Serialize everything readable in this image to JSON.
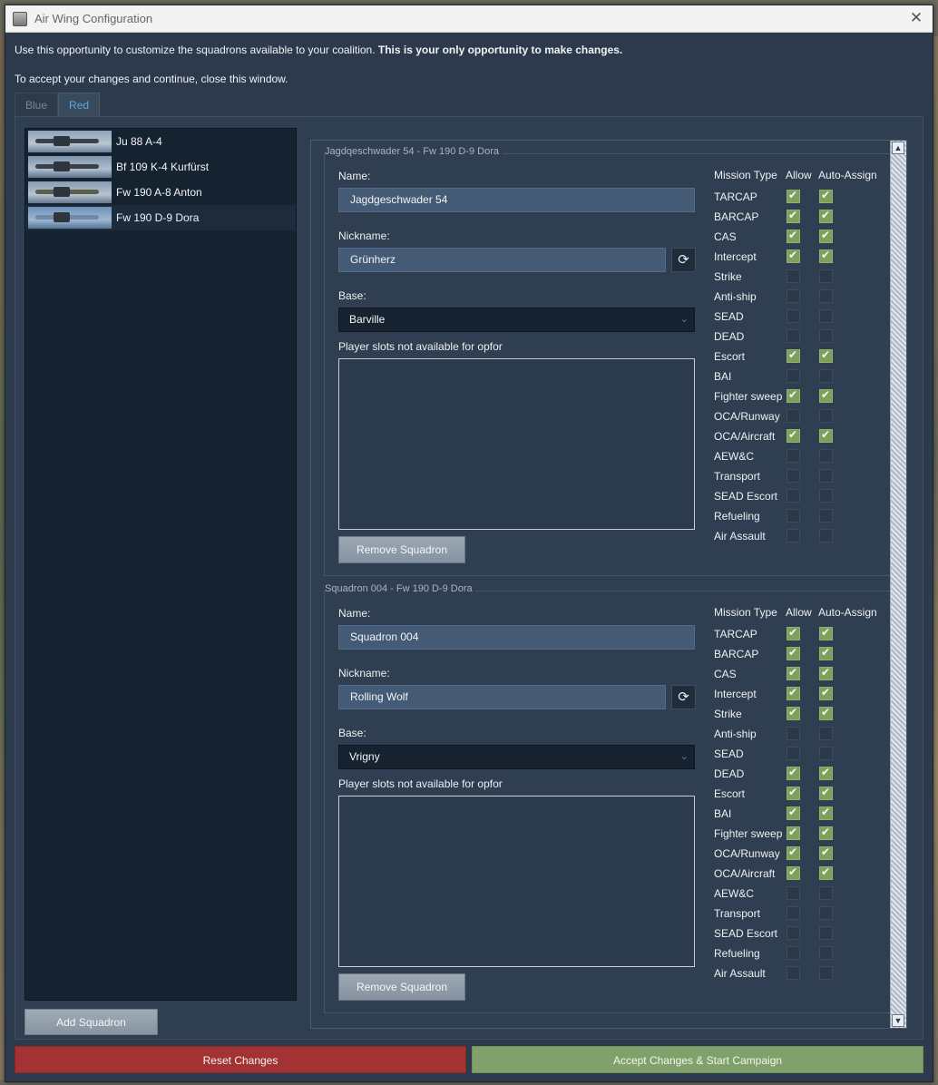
{
  "window": {
    "title": "Air Wing Configuration",
    "close_glyph": "✕"
  },
  "intro": {
    "text": "Use this opportunity to customize the squadrons available to your coalition. ",
    "bold": "This is your only opportunity to make changes.",
    "line2": "To accept your changes and continue, close this window."
  },
  "tabs": [
    {
      "label": "Blue"
    },
    {
      "label": "Red"
    }
  ],
  "aircraft": [
    {
      "label": "Ju 88 A-4"
    },
    {
      "label": "Bf 109 K-4 Kurfürst"
    },
    {
      "label": "Fw 190 A-8 Anton"
    },
    {
      "label": "Fw 190 D-9 Dora"
    }
  ],
  "add_squadron_label": "Add Squadron",
  "labels": {
    "name": "Name:",
    "nickname": "Nickname:",
    "base": "Base:",
    "slots": "Player slots not available for opfor",
    "remove": "Remove Squadron",
    "mission_type": "Mission Type",
    "allow": "Allow",
    "auto_assign": "Auto-Assign",
    "refresh_glyph": "⟳",
    "dropdown_glyph": "⌄"
  },
  "squadrons": [
    {
      "title": "Jagdqeschwader 54 - Fw 190 D-9 Dora",
      "name": "Jagdgeschwader 54",
      "nickname": "Grünherz",
      "base": "Barville",
      "missions": [
        {
          "name": "TARCAP",
          "allow": true,
          "auto": true
        },
        {
          "name": "BARCAP",
          "allow": true,
          "auto": true
        },
        {
          "name": "CAS",
          "allow": true,
          "auto": true
        },
        {
          "name": "Intercept",
          "allow": true,
          "auto": true
        },
        {
          "name": "Strike",
          "allow": false,
          "auto": false
        },
        {
          "name": "Anti-ship",
          "allow": false,
          "auto": false
        },
        {
          "name": "SEAD",
          "allow": false,
          "auto": false
        },
        {
          "name": "DEAD",
          "allow": false,
          "auto": false
        },
        {
          "name": "Escort",
          "allow": true,
          "auto": true
        },
        {
          "name": "BAI",
          "allow": false,
          "auto": false
        },
        {
          "name": "Fighter sweep",
          "allow": true,
          "auto": true
        },
        {
          "name": "OCA/Runway",
          "allow": false,
          "auto": false
        },
        {
          "name": "OCA/Aircraft",
          "allow": true,
          "auto": true
        },
        {
          "name": "AEW&C",
          "allow": false,
          "auto": false
        },
        {
          "name": "Transport",
          "allow": false,
          "auto": false
        },
        {
          "name": "SEAD Escort",
          "allow": false,
          "auto": false
        },
        {
          "name": "Refueling",
          "allow": false,
          "auto": false
        },
        {
          "name": "Air Assault",
          "allow": false,
          "auto": false
        }
      ]
    },
    {
      "title": "Squadron 004 - Fw 190 D-9 Dora",
      "name": "Squadron 004",
      "nickname": "Rolling Wolf",
      "base": "Vrigny",
      "missions": [
        {
          "name": "TARCAP",
          "allow": true,
          "auto": true
        },
        {
          "name": "BARCAP",
          "allow": true,
          "auto": true
        },
        {
          "name": "CAS",
          "allow": true,
          "auto": true
        },
        {
          "name": "Intercept",
          "allow": true,
          "auto": true
        },
        {
          "name": "Strike",
          "allow": true,
          "auto": true
        },
        {
          "name": "Anti-ship",
          "allow": false,
          "auto": false
        },
        {
          "name": "SEAD",
          "allow": false,
          "auto": false
        },
        {
          "name": "DEAD",
          "allow": true,
          "auto": true
        },
        {
          "name": "Escort",
          "allow": true,
          "auto": true
        },
        {
          "name": "BAI",
          "allow": true,
          "auto": true
        },
        {
          "name": "Fighter sweep",
          "allow": true,
          "auto": true
        },
        {
          "name": "OCA/Runway",
          "allow": true,
          "auto": true
        },
        {
          "name": "OCA/Aircraft",
          "allow": true,
          "auto": true
        },
        {
          "name": "AEW&C",
          "allow": false,
          "auto": false
        },
        {
          "name": "Transport",
          "allow": false,
          "auto": false
        },
        {
          "name": "SEAD Escort",
          "allow": false,
          "auto": false
        },
        {
          "name": "Refueling",
          "allow": false,
          "auto": false
        },
        {
          "name": "Air Assault",
          "allow": false,
          "auto": false
        }
      ]
    }
  ],
  "footer": {
    "reset": "Reset Changes",
    "accept": "Accept Changes & Start Campaign"
  },
  "scroll_arrows": {
    "up": "▲",
    "down": "▼"
  },
  "colors": {
    "accent_tab": "#5aa8e0",
    "checkbox_on": "#7fa05c",
    "reset": "#a33232",
    "accept": "#80a26a"
  }
}
